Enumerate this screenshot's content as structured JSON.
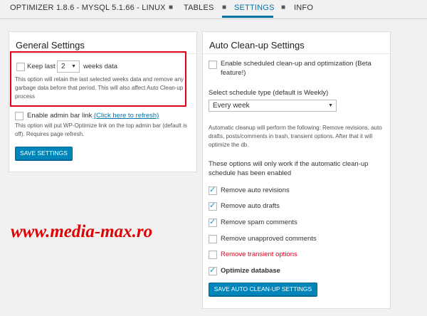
{
  "nav": {
    "title": "OPTIMIZER 1.8.6 - MYSQL 5.1.66 - LINUX",
    "tabs": [
      "TABLES",
      "SETTINGS",
      "INFO"
    ]
  },
  "general": {
    "title": "General Settings",
    "keep_prefix": "Keep last",
    "keep_value": "2",
    "keep_suffix": "weeks data",
    "keep_desc": "This option will retain the last selected weeks data and remove any garbage data before that period. This will also affect Auto Clean-up process",
    "admin_bar_label": "Enable admin bar link",
    "admin_bar_link": "(Click here to refresh)",
    "admin_bar_desc": "This option will put WP-Optimize link on the top admin bar (default is off). Requires page refresh.",
    "save_button": "SAVE SETTINGS"
  },
  "auto": {
    "title": "Auto Clean-up Settings",
    "enable_label": "Enable scheduled clean-up and optimization (Beta feature!)",
    "schedule_label": "Select schedule type (default is Weekly)",
    "schedule_value": "Every week",
    "info": "Automatic cleanup will perform the following: Remove revisions, auto drafts, posts/comments in trash, transient options. After that it will optimize the db.",
    "note": "These options will only work if the automatic clean-up schedule has been enabled",
    "options": [
      {
        "label": "Remove auto revisions",
        "checked": true
      },
      {
        "label": "Remove auto drafts",
        "checked": true
      },
      {
        "label": "Remove spam comments",
        "checked": true
      },
      {
        "label": "Remove unapproved comments",
        "checked": false
      },
      {
        "label": "Remove transient options",
        "checked": false
      },
      {
        "label": "Optimize database",
        "checked": true
      }
    ],
    "save_button": "SAVE AUTO CLEAN-UP SETTINGS"
  },
  "watermark": "www.media-max.ro",
  "colors": {
    "accent": "#0073aa",
    "button": "#0085ba",
    "warning": "#e2001a"
  }
}
